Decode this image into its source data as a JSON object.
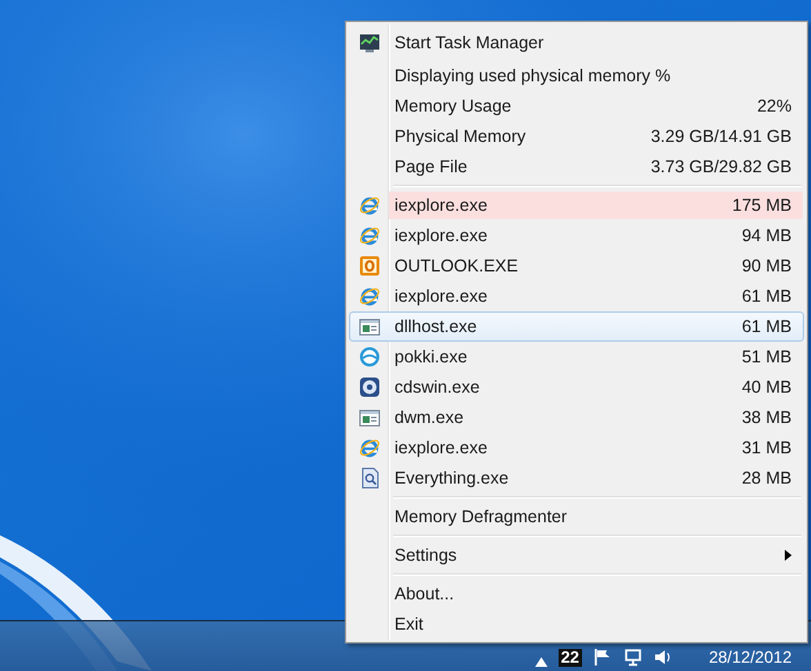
{
  "menu": {
    "header": {
      "label": "Start Task Manager"
    },
    "caption": "Displaying used physical memory %",
    "stats": [
      {
        "label": "Memory Usage",
        "value": "22%"
      },
      {
        "label": "Physical Memory",
        "value": "3.29 GB/14.91 GB"
      },
      {
        "label": "Page File",
        "value": "3.73 GB/29.82 GB"
      }
    ],
    "processes": [
      {
        "name": "iexplore.exe",
        "memory": "175 MB",
        "kind": "browser",
        "highlighted": true,
        "selected": false
      },
      {
        "name": "iexplore.exe",
        "memory": "94 MB",
        "kind": "browser",
        "highlighted": false,
        "selected": false
      },
      {
        "name": "OUTLOOK.EXE",
        "memory": "90 MB",
        "kind": "mail",
        "highlighted": false,
        "selected": false
      },
      {
        "name": "iexplore.exe",
        "memory": "61 MB",
        "kind": "browser",
        "highlighted": false,
        "selected": false
      },
      {
        "name": "dllhost.exe",
        "memory": "61 MB",
        "kind": "window",
        "highlighted": false,
        "selected": true
      },
      {
        "name": "pokki.exe",
        "memory": "51 MB",
        "kind": "ring",
        "highlighted": false,
        "selected": false
      },
      {
        "name": "cdswin.exe",
        "memory": "40 MB",
        "kind": "disc",
        "highlighted": false,
        "selected": false
      },
      {
        "name": "dwm.exe",
        "memory": "38 MB",
        "kind": "window",
        "highlighted": false,
        "selected": false
      },
      {
        "name": "iexplore.exe",
        "memory": "31 MB",
        "kind": "browser",
        "highlighted": false,
        "selected": false
      },
      {
        "name": "Everything.exe",
        "memory": "28 MB",
        "kind": "document",
        "highlighted": false,
        "selected": false
      }
    ],
    "command_groups": [
      [
        {
          "label": "Memory Defragmenter",
          "submenu": false
        }
      ],
      [
        {
          "label": "Settings",
          "submenu": true
        }
      ],
      [
        {
          "label": "About...",
          "submenu": false
        },
        {
          "label": "Exit",
          "submenu": false
        }
      ]
    ]
  },
  "taskbar": {
    "tray_badge": "22",
    "date": "28/12/2012"
  }
}
